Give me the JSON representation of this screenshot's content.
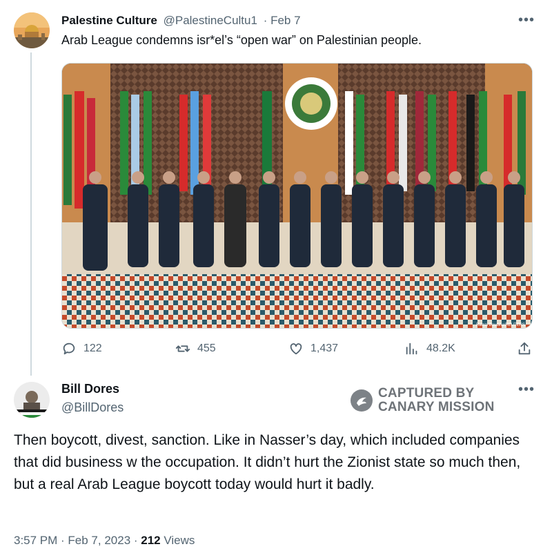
{
  "tweet1": {
    "display_name": "Palestine Culture",
    "handle": "@PalestineCultu1",
    "date": "· Feb 7",
    "more_icon": "more-horizontal-icon",
    "text": "Arab League condemns isr*el’s “open war” on Palestinian people.",
    "image_description": "group-photo-arab-league-summit",
    "watermark": "Ramzi Boudina/REUTERS",
    "stats": {
      "replies": "122",
      "retweets": "455",
      "likes": "1,437",
      "views": "48.2K"
    }
  },
  "tweet2": {
    "display_name": "Bill Dores",
    "handle": "@BillDores",
    "badge_line1": "CAPTURED BY",
    "badge_line2": "CANARY MISSION",
    "text": "Then boycott, divest, sanction. Like in Nasser’s day, which included companies that did business w the occupation. It didn’t hurt the Zionist state so much then, but a real Arab League boycott today would hurt it badly.",
    "time": "3:57 PM · Feb 7, 2023 · ",
    "views_count": "212",
    "views_label": " Views"
  },
  "colors": {
    "text": "#0f1419",
    "secondary": "#536471",
    "divider": "#cfd9de"
  }
}
